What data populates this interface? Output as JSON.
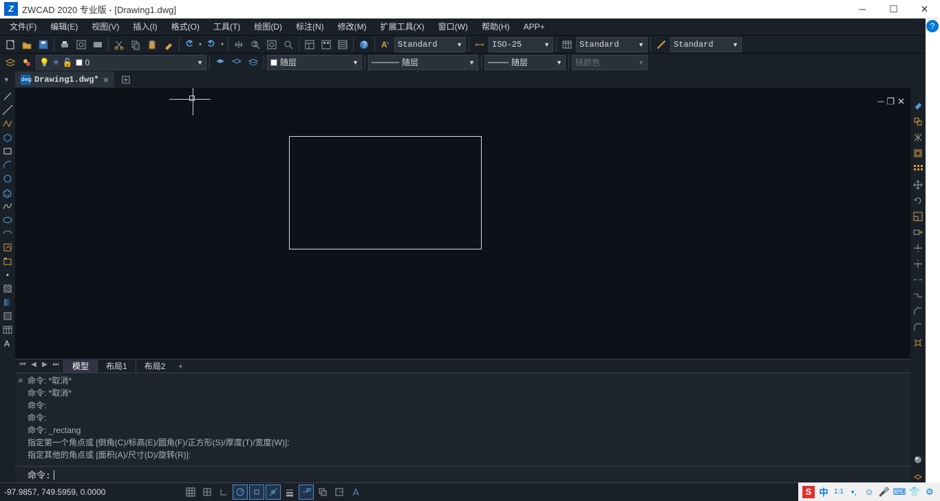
{
  "title": "ZWCAD 2020 专业版 - [Drawing1.dwg]",
  "menu": [
    "文件(F)",
    "编辑(E)",
    "视图(V)",
    "插入(I)",
    "格式(O)",
    "工具(T)",
    "绘图(D)",
    "标注(N)",
    "修改(M)",
    "扩展工具(X)",
    "窗口(W)",
    "帮助(H)",
    "APP+"
  ],
  "tb2": {
    "textstyle": "Standard",
    "dimstyle": "ISO-25",
    "tablestyle": "Standard",
    "mlstyle": "Standard"
  },
  "layer": {
    "current": "0"
  },
  "props": {
    "color": "随层",
    "linetype": "随层",
    "lineweight": "随层",
    "print": "随颜色"
  },
  "drawingTab": "Drawing1.dwg*",
  "layouts": {
    "model": "模型",
    "l1": "布局1",
    "l2": "布局2"
  },
  "cmd": {
    "h1": "命令: *取消*",
    "h2": "命令: *取消*",
    "h3": "命令:",
    "h4": "命令:",
    "h5": "命令: _rectang",
    "h6": "指定第一个角点或 [倒角(C)/标高(E)/圆角(F)/正方形(S)/厚度(T)/宽度(W)]:",
    "h7": "指定其他的角点或 [面积(A)/尺寸(D)/旋转(R)]:",
    "prompt": "命令:"
  },
  "status": {
    "coords": "-97.9857, 749.5959, 0.0000"
  },
  "tray": {
    "lang": "中",
    "ratio": "1:1"
  }
}
